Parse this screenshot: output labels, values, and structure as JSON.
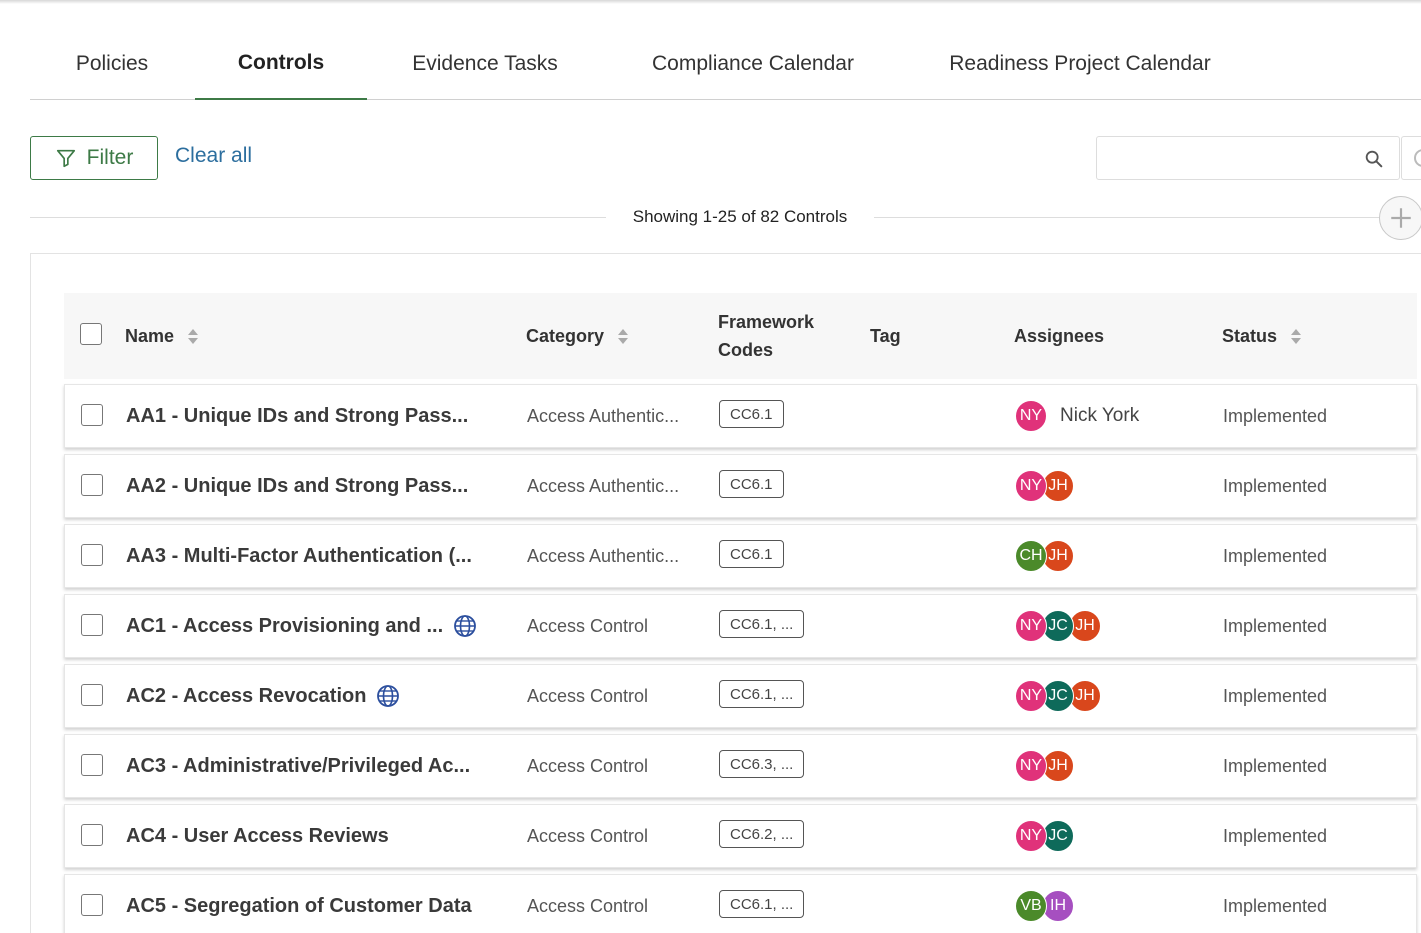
{
  "tabs": [
    {
      "label": "Policies",
      "active": false
    },
    {
      "label": "Controls",
      "active": true
    },
    {
      "label": "Evidence Tasks",
      "active": false
    },
    {
      "label": "Compliance Calendar",
      "active": false
    },
    {
      "label": "Readiness Project Calendar",
      "active": false
    }
  ],
  "toolbar": {
    "filter_label": "Filter",
    "clear_all_label": "Clear all",
    "search_value": ""
  },
  "showing_text": "Showing 1-25 of 82 Controls",
  "table": {
    "columns": {
      "name": "Name",
      "category": "Category",
      "framework_codes": "Framework Codes",
      "tag": "Tag",
      "assignees": "Assignees",
      "status": "Status"
    },
    "rows": [
      {
        "name": "AA1 - Unique IDs and Strong Pass...",
        "globe": false,
        "category": "Access Authentic...",
        "code": "CC6.1",
        "assignees": [
          {
            "initials": "NY",
            "color": "#e0327a"
          }
        ],
        "assignee_name": "Nick York",
        "status": "Implemented"
      },
      {
        "name": "AA2 - Unique IDs and Strong Pass...",
        "globe": false,
        "category": "Access Authentic...",
        "code": "CC6.1",
        "assignees": [
          {
            "initials": "NY",
            "color": "#e0327a"
          },
          {
            "initials": "JH",
            "color": "#d9471c"
          }
        ],
        "assignee_name": "",
        "status": "Implemented"
      },
      {
        "name": "AA3 - Multi-Factor Authentication (...",
        "globe": false,
        "category": "Access Authentic...",
        "code": "CC6.1",
        "assignees": [
          {
            "initials": "CH",
            "color": "#4b8a2a"
          },
          {
            "initials": "JH",
            "color": "#d9471c"
          }
        ],
        "assignee_name": "",
        "status": "Implemented"
      },
      {
        "name": "AC1 - Access Provisioning and ...",
        "globe": true,
        "category": "Access Control",
        "code": "CC6.1, ...",
        "assignees": [
          {
            "initials": "NY",
            "color": "#e0327a"
          },
          {
            "initials": "JC",
            "color": "#0e6a5a"
          },
          {
            "initials": "JH",
            "color": "#d9471c"
          }
        ],
        "assignee_name": "",
        "status": "Implemented"
      },
      {
        "name": "AC2 - Access Revocation",
        "globe": true,
        "category": "Access Control",
        "code": "CC6.1, ...",
        "assignees": [
          {
            "initials": "NY",
            "color": "#e0327a"
          },
          {
            "initials": "JC",
            "color": "#0e6a5a"
          },
          {
            "initials": "JH",
            "color": "#d9471c"
          }
        ],
        "assignee_name": "",
        "status": "Implemented"
      },
      {
        "name": "AC3 - Administrative/Privileged Ac...",
        "globe": false,
        "category": "Access Control",
        "code": "CC6.3, ...",
        "assignees": [
          {
            "initials": "NY",
            "color": "#e0327a"
          },
          {
            "initials": "JH",
            "color": "#d9471c"
          }
        ],
        "assignee_name": "",
        "status": "Implemented"
      },
      {
        "name": "AC4 - User Access Reviews",
        "globe": false,
        "category": "Access Control",
        "code": "CC6.2, ...",
        "assignees": [
          {
            "initials": "NY",
            "color": "#e0327a"
          },
          {
            "initials": "JC",
            "color": "#0e6a5a"
          }
        ],
        "assignee_name": "",
        "status": "Implemented"
      },
      {
        "name": "AC5 - Segregation of Customer Data",
        "globe": false,
        "category": "Access Control",
        "code": "CC6.1, ...",
        "assignees": [
          {
            "initials": "VB",
            "color": "#4b8a2a"
          },
          {
            "initials": "IH",
            "color": "#a64fc0"
          }
        ],
        "assignee_name": "",
        "status": "Implemented"
      }
    ]
  },
  "colors": {
    "brand_green": "#3d7a46",
    "link_blue": "#2c6e9e"
  }
}
